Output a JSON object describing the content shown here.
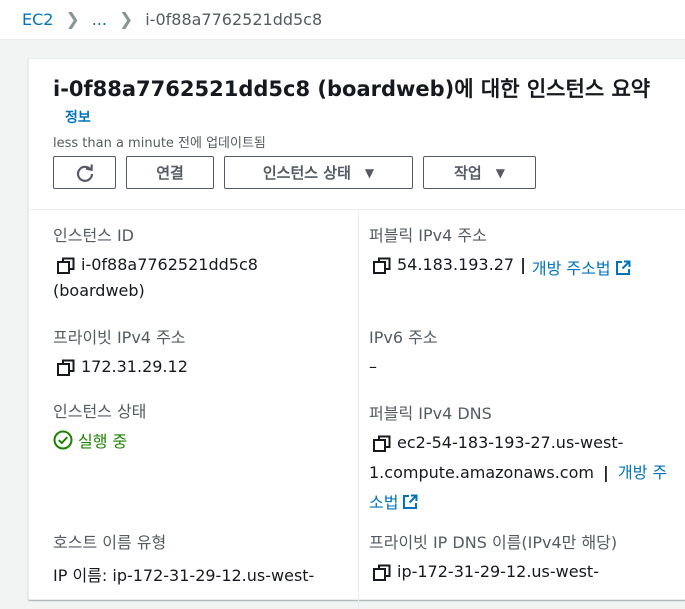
{
  "breadcrumb": {
    "root": "EC2",
    "middle": "...",
    "current": "i-0f88a7762521dd5c8",
    "separator": "❯"
  },
  "summary": {
    "title": "i-0f88a7762521dd5c8 (boardweb)에 대한 인스턴스 요약",
    "info_link": "정보",
    "updated": "less than a minute 전에 업데이트됨"
  },
  "toolbar": {
    "connect_label": "연결",
    "state_label": "인스턴스 상태",
    "actions_label": "작업"
  },
  "fields": {
    "instance_id": {
      "label": "인스턴스 ID",
      "value_line1": "i-0f88a7762521dd5c8",
      "value_line2": "(boardweb)"
    },
    "public_ipv4": {
      "label": "퍼블릭 IPv4 주소",
      "value": "54.183.193.27",
      "separator": "|",
      "link": "개방 주소법"
    },
    "private_ipv4": {
      "label": "프라이빗 IPv4 주소",
      "value": "172.31.29.12"
    },
    "ipv6": {
      "label": "IPv6 주소",
      "value": "–"
    },
    "instance_state": {
      "label": "인스턴스 상태",
      "value": "실행 중"
    },
    "public_dns": {
      "label": "퍼블릭 IPv4 DNS",
      "value_line1": "ec2-54-183-193-27.us-west-",
      "value_line2": "1.compute.amazonaws.com",
      "separator": "|",
      "link_part1": "개방 주",
      "link_part2": "소법"
    },
    "hostname_type": {
      "label": "호스트 이름 유형",
      "value": "IP 이름: ip-172-31-29-12.us-west-"
    },
    "private_dns": {
      "label": "프라이빗 IP DNS 이름(IPv4만 해당)",
      "value": "ip-172-31-29-12.us-west-"
    }
  },
  "colors": {
    "link": "#0073bb",
    "running": "#1d8102",
    "label": "#545b64"
  }
}
